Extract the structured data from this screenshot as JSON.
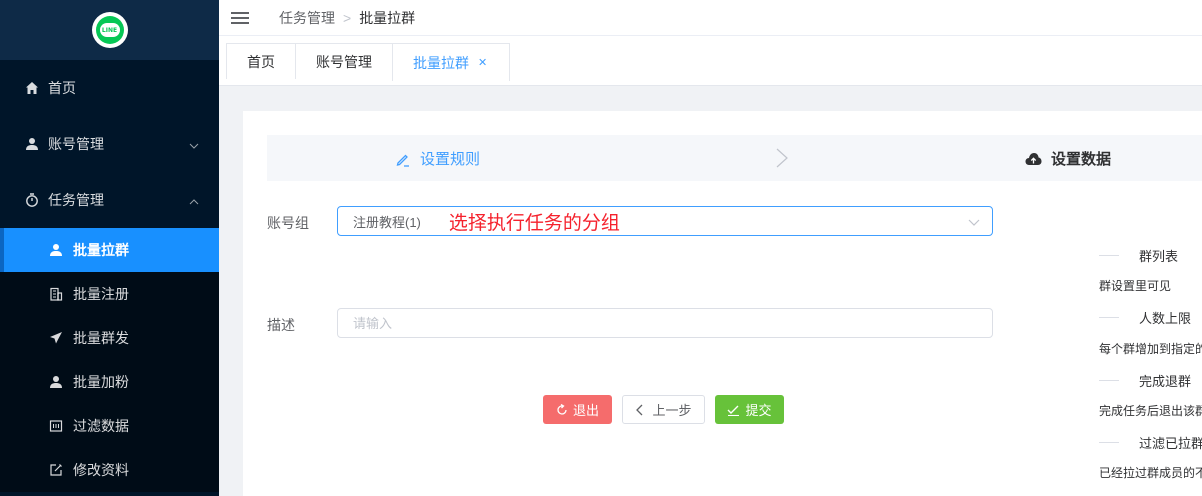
{
  "logo": {
    "text": "LINE",
    "color": "#06c755"
  },
  "sidebar": {
    "items": [
      {
        "label": "首页",
        "icon": "home-icon"
      },
      {
        "label": "账号管理",
        "icon": "user-icon"
      },
      {
        "label": "任务管理",
        "icon": "stopwatch-icon"
      }
    ],
    "task_submenu": [
      {
        "label": "批量拉群",
        "icon": "user-icon",
        "active": true
      },
      {
        "label": "批量注册",
        "icon": "building-icon"
      },
      {
        "label": "批量群发",
        "icon": "send-icon"
      },
      {
        "label": "批量加粉",
        "icon": "user-icon"
      },
      {
        "label": "过滤数据",
        "icon": "filter-box-icon"
      },
      {
        "label": "修改资料",
        "icon": "edit-icon"
      }
    ]
  },
  "breadcrumb": {
    "parent": "任务管理",
    "current": "批量拉群"
  },
  "tabs": [
    {
      "label": "首页"
    },
    {
      "label": "账号管理"
    },
    {
      "label": "批量拉群",
      "active": true
    }
  ],
  "steps": [
    {
      "label": "设置规则",
      "icon": "edit-icon",
      "active": true
    },
    {
      "label": "设置数据",
      "icon": "cloud-upload-icon",
      "active": false
    }
  ],
  "form": {
    "account_group": {
      "label": "账号组",
      "value": "注册教程(1)",
      "annotation": "选择执行任务的分组"
    },
    "description": {
      "label": "描述",
      "placeholder": "请输入"
    }
  },
  "buttons": {
    "exit": "退出",
    "prev": "上一步",
    "submit": "提交"
  },
  "help": [
    {
      "title": "群列表",
      "desc": "群设置里可见"
    },
    {
      "title": "人数上限",
      "desc": "每个群增加到指定的"
    },
    {
      "title": "完成退群",
      "desc": "完成任务后退出该群"
    },
    {
      "title": "过滤已拉群",
      "desc": "已经拉过群成员的不"
    }
  ],
  "colors": {
    "sidebar_bg": "#001529",
    "active": "#1890ff",
    "primary": "#409eff",
    "danger": "#f56c6c",
    "success": "#67c23a",
    "annotation": "#f5222d"
  }
}
